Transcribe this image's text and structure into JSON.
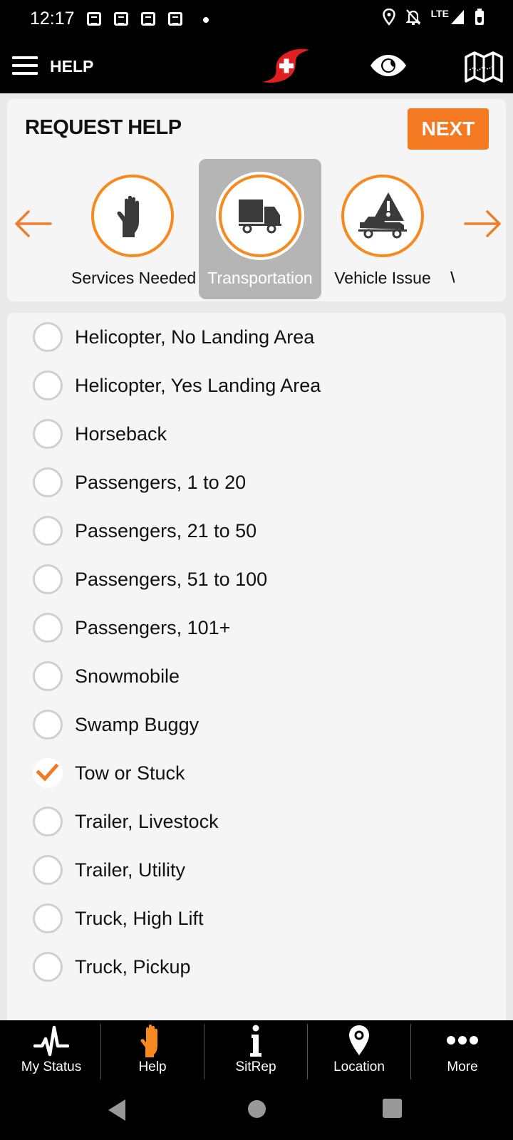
{
  "status_bar": {
    "time": "12:17",
    "notification_icons": [
      "news-icon",
      "news-icon",
      "news-icon",
      "news-icon"
    ],
    "network": "LTE",
    "right_icons": [
      "location-icon",
      "bell-off-icon",
      "signal-icon",
      "battery-icon"
    ]
  },
  "app_bar": {
    "title": "HELP",
    "icons": [
      "menu-icon",
      "app-logo",
      "eye-icon",
      "map-icon"
    ]
  },
  "request": {
    "heading": "REQUEST HELP",
    "next_label": "NEXT",
    "categories": [
      {
        "label": "Services Needed",
        "icon": "hand-icon",
        "selected": false
      },
      {
        "label": "Transportation",
        "icon": "truck-icon",
        "selected": true
      },
      {
        "label": "Vehicle Issue",
        "icon": "vehicle-warning-icon",
        "selected": false
      },
      {
        "label": "W",
        "icon": "",
        "selected": false
      }
    ]
  },
  "options": [
    {
      "label": "Helicopter, No Landing Area",
      "checked": false
    },
    {
      "label": "Helicopter, Yes Landing Area",
      "checked": false
    },
    {
      "label": "Horseback",
      "checked": false
    },
    {
      "label": "Passengers, 1 to 20",
      "checked": false
    },
    {
      "label": "Passengers, 21 to 50",
      "checked": false
    },
    {
      "label": "Passengers, 51 to 100",
      "checked": false
    },
    {
      "label": "Passengers, 101+",
      "checked": false
    },
    {
      "label": "Snowmobile",
      "checked": false
    },
    {
      "label": "Swamp Buggy",
      "checked": false
    },
    {
      "label": "Tow or Stuck",
      "checked": true
    },
    {
      "label": "Trailer, Livestock",
      "checked": false
    },
    {
      "label": "Trailer, Utility",
      "checked": false
    },
    {
      "label": "Truck, High Lift",
      "checked": false
    },
    {
      "label": "Truck, Pickup",
      "checked": false
    }
  ],
  "bottom_nav": [
    {
      "label": "My Status",
      "icon": "pulse-icon"
    },
    {
      "label": "Help",
      "icon": "hand-icon",
      "active": true
    },
    {
      "label": "SitRep",
      "icon": "info-icon"
    },
    {
      "label": "Location",
      "icon": "location-pin-icon"
    },
    {
      "label": "More",
      "icon": "more-dots-icon"
    }
  ],
  "colors": {
    "accent": "#f47920",
    "selected_tile": "#b5b5b5",
    "card_bg": "#f5f5f5",
    "logo_red": "#e02020"
  }
}
